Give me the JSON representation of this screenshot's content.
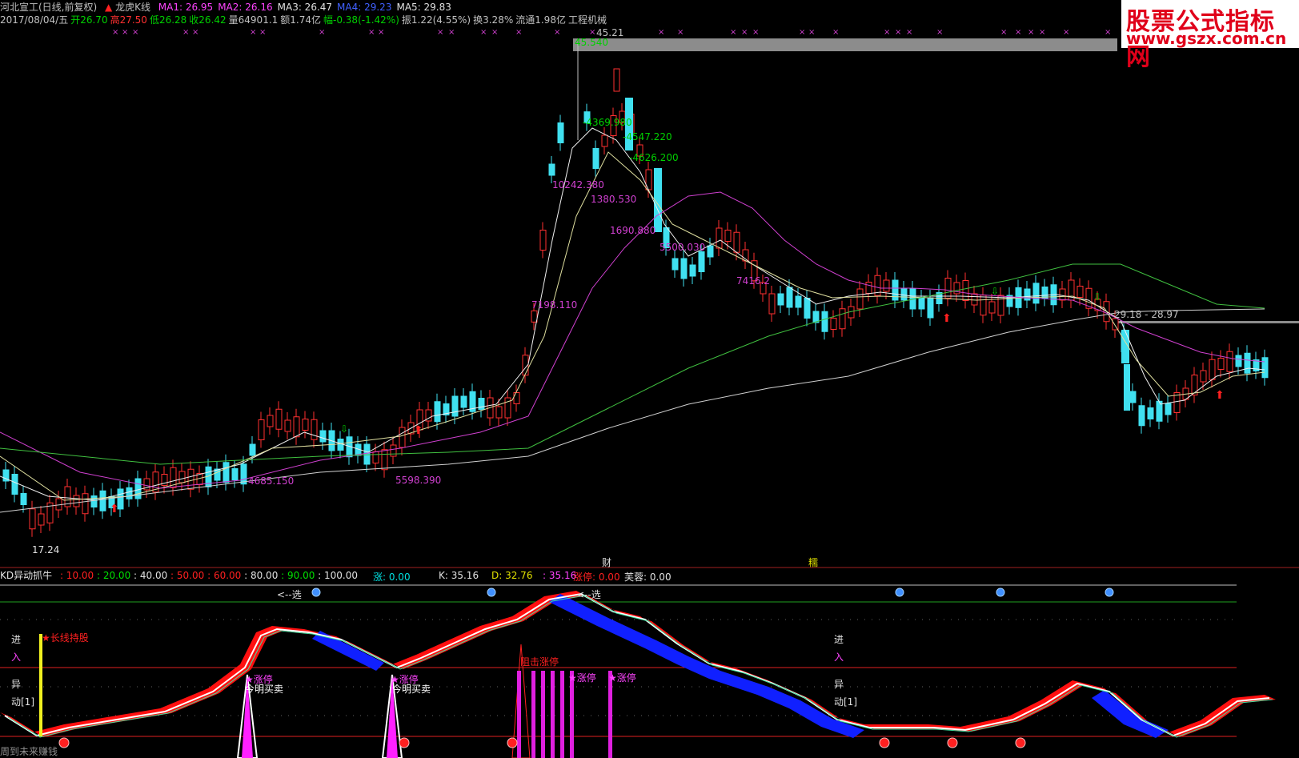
{
  "header": {
    "title": "河北宣工(日线,前复权)",
    "indicator_name": "龙虎K线",
    "ma": [
      {
        "label": "MA1: 26.95",
        "color": "#ff44ff"
      },
      {
        "label": "MA2: 26.16",
        "color": "#ff44ff"
      },
      {
        "label": "MA3: 26.47",
        "color": "#e0e0e0"
      },
      {
        "label": "MA4: 29.23",
        "color": "#4060ff"
      },
      {
        "label": "MA5: 29.83",
        "color": "#e0e0e0"
      }
    ]
  },
  "quote": [
    {
      "text": "2017/08/04/五",
      "color": "#c0c0c0"
    },
    {
      "text": "开26.70",
      "color": "#00d000"
    },
    {
      "text": "高27.50",
      "color": "#ff3030"
    },
    {
      "text": "低26.28",
      "color": "#00d000"
    },
    {
      "text": "收26.42",
      "color": "#00d000"
    },
    {
      "text": "量64901.1",
      "color": "#c0c0c0"
    },
    {
      "text": "额1.74亿",
      "color": "#c0c0c0"
    },
    {
      "text": "幅-0.38(-1.42%)",
      "color": "#00d000"
    },
    {
      "text": "振1.22(4.55%)",
      "color": "#c0c0c0"
    },
    {
      "text": "换3.28%",
      "color": "#c0c0c0"
    },
    {
      "text": "流通1.98亿",
      "color": "#c0c0c0"
    },
    {
      "text": "工程机械",
      "color": "#c0c0c0"
    }
  ],
  "watermark": {
    "line1": "股票公式指标网",
    "line2": "www.gszx.com.cn"
  },
  "price_labels": {
    "top_value": "45.21",
    "top_mark": "45.540",
    "low": "17.24",
    "right_range": "29.18 - 28.97",
    "annotations": [
      "-4369.980",
      "-4547.220",
      "-4626.200",
      "10242.380",
      "1380.530",
      "1690.880",
      "5500.030",
      "7198.110",
      "4685.150",
      "5598.390",
      "7416.2"
    ]
  },
  "markers": {
    "cai": "财",
    "xu": "糯"
  },
  "lower_panel": {
    "title": "KD异动抓牛",
    "levels": [
      "10.00",
      "20.00",
      "40.00",
      "50.00",
      "60.00",
      "80.00",
      "90.00",
      "100.00"
    ],
    "zhang": "涨: 0.00",
    "kd": [
      "K: 35.16",
      "D: 32.76",
      ": 35.16"
    ],
    "zhangting": "涨停: 0.00",
    "fuorong": "芙蓉: 0.00",
    "select_left": "<--选",
    "select_right": "<--选",
    "jin": "进",
    "ru": "入",
    "yi": "异",
    "dong": "动[1]",
    "long_hold": "★长线持股",
    "limit_up": "★涨停",
    "ming_trade": "今明买卖",
    "block_limit": "阻击涨停",
    "bottom_text": "周到未来赚钱"
  }
}
